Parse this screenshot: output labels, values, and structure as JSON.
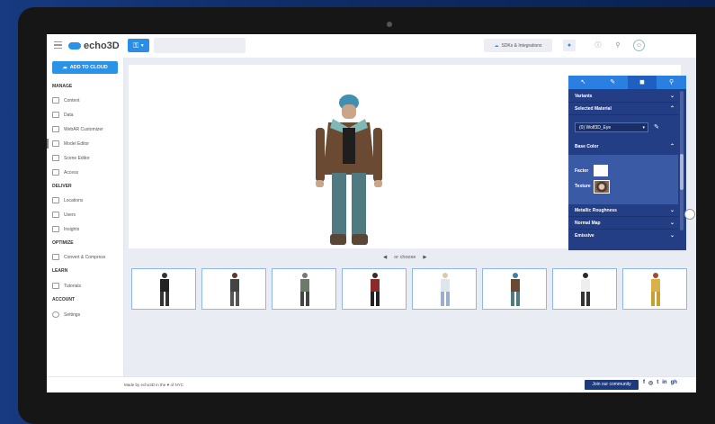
{
  "app": {
    "name": "echo3D"
  },
  "header": {
    "sdk_label": "SDKs & Integrations",
    "icons": [
      "hamburger-icon",
      "key-icon",
      "cloud-icon",
      "notification-icon",
      "info-icon",
      "search-icon",
      "user-icon"
    ]
  },
  "sidebar": {
    "add_to_cloud": "ADD TO CLOUD",
    "sections": {
      "manage": "MANAGE",
      "deliver": "DELIVER",
      "optimize": "OPTIMIZE",
      "learn": "LEARN",
      "account": "ACCOUNT"
    },
    "items": {
      "content": "Content",
      "data": "Data",
      "webar": "WebAR Customizer",
      "model_editor": "Model Editor",
      "scene_editor": "Scene Editor",
      "access": "Access",
      "locations": "Locations",
      "users": "Users",
      "insights": "Insights",
      "convert": "Convert & Compress",
      "tutorials": "Tutorials",
      "settings": "Settings"
    }
  },
  "panel": {
    "tabs": [
      "transform-icon",
      "pencil-icon",
      "palette-icon",
      "search-icon"
    ],
    "variants": "Variants",
    "selected_material": "Selected Material",
    "material_value": "(0) Wolf3D_Eye",
    "base_color": "Base Color",
    "factor": "Factor",
    "texture": "Texture",
    "metallic": "Metallic Roughness",
    "normal": "Normal Map",
    "emissive": "Emissive"
  },
  "carousel": {
    "choose": "or choose"
  },
  "footer": {
    "made_by": "Made by echo3D in the ♥ of NYC",
    "community": "Join our community",
    "social": [
      "f",
      "◎",
      "t",
      "in",
      "gh"
    ]
  },
  "colors": {
    "accent": "#2a93e8",
    "panel": "#233e84",
    "panel_active": "#3b5aa6"
  }
}
